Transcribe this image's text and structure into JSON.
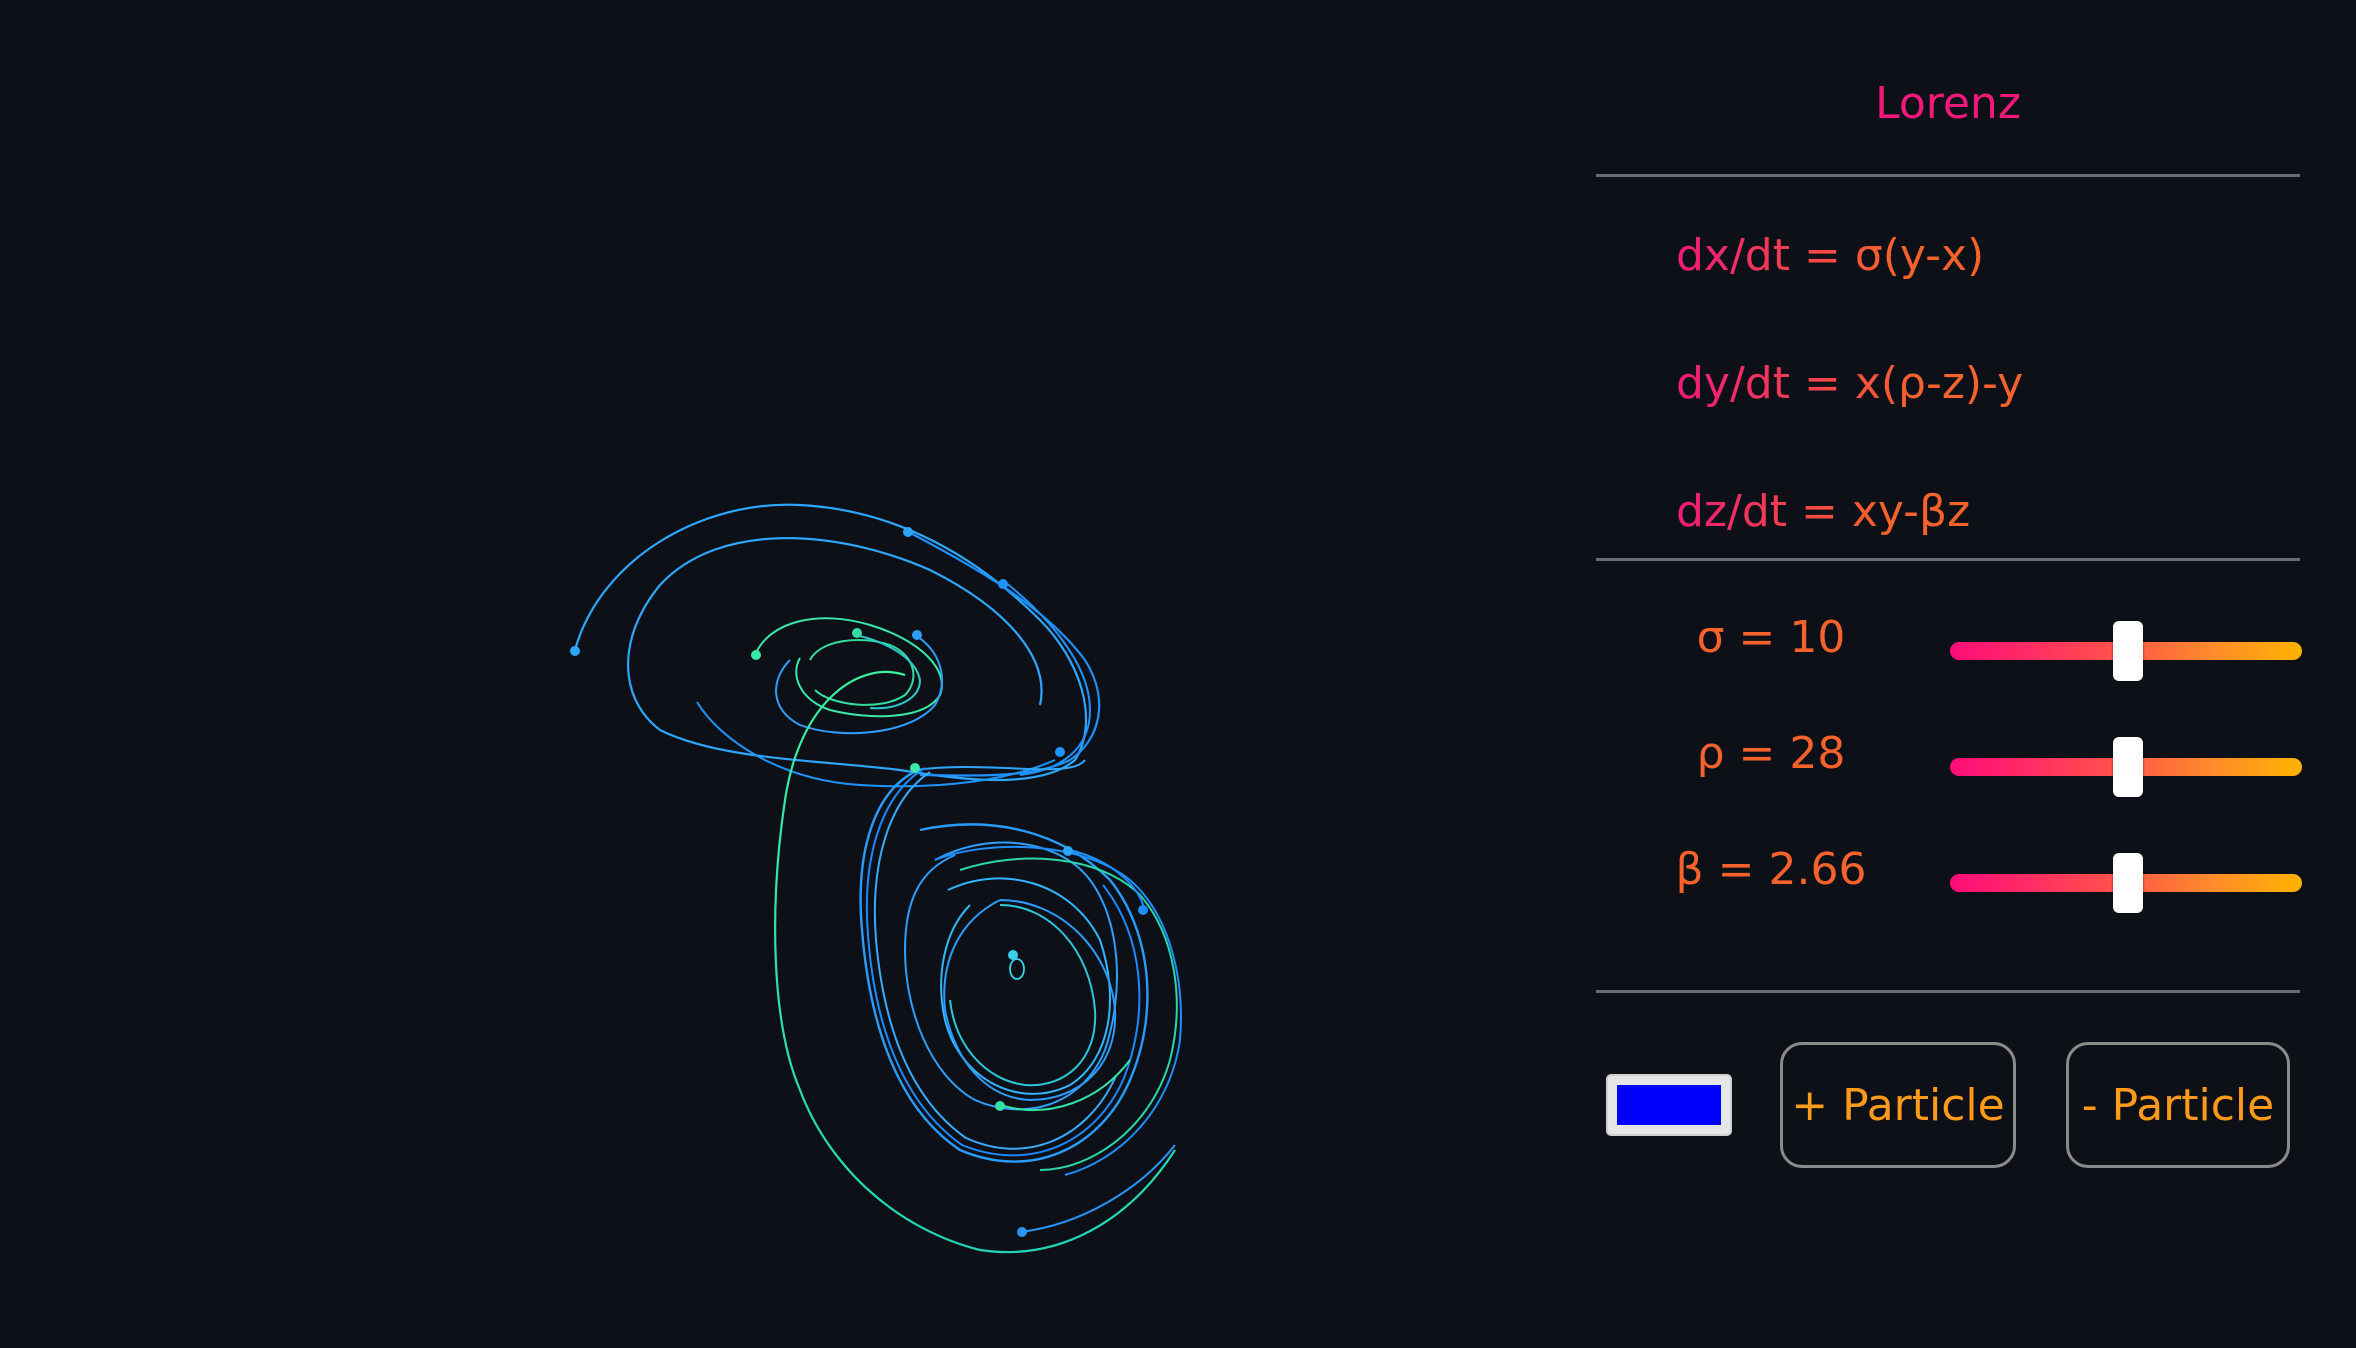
{
  "panel": {
    "title": "Lorenz",
    "equations": [
      "dx/dt = σ(y-x)",
      "dy/dt = x(ρ-z)-y",
      "dz/dt = xy-βz"
    ],
    "params": [
      {
        "label": "σ = 10",
        "name": "sigma",
        "value": 10,
        "fraction": 0.5
      },
      {
        "label": "ρ = 28",
        "name": "rho",
        "value": 28,
        "fraction": 0.5
      },
      {
        "label": "β = 2.66",
        "name": "beta",
        "value": 2.66,
        "fraction": 0.5
      }
    ],
    "color_picker": {
      "value": "#0000ff"
    },
    "add_button": "+ Particle",
    "remove_button": "- Particle"
  },
  "colors": {
    "background": "#0d1117",
    "accent_pink": "#f0197a",
    "accent_orange": "#ff9a1a",
    "trail_cyan": "#2aa8ff",
    "trail_green": "#2ee6a6"
  }
}
